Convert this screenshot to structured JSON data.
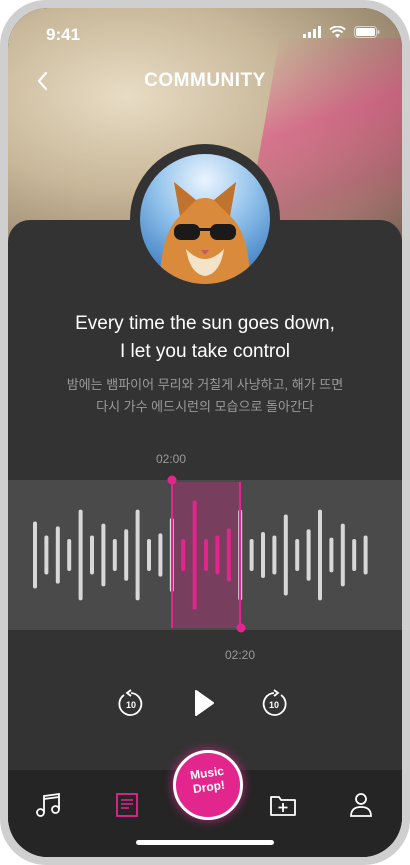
{
  "status": {
    "time": "9:41"
  },
  "header": {
    "title": "COMMUNITY"
  },
  "lyrics": {
    "english_line1": "Every time the sun goes down,",
    "english_line2": "I let you take control",
    "korean_line1": "밤에는 뱀파이어 무리와 거칠게 사냥하고, 해가 뜨면",
    "korean_line2": "다시 가수 에드시런의 모습으로 돌아간다"
  },
  "clip": {
    "start_time": "02:00",
    "end_time": "02:20"
  },
  "player": {
    "rewind_seconds": "10",
    "forward_seconds": "10"
  },
  "fab": {
    "label": "Music\nDrop!"
  },
  "tabs": [
    {
      "icon": "music-note-icon",
      "active": false
    },
    {
      "icon": "document-icon",
      "active": true
    },
    {
      "icon": "folder-add-icon",
      "active": false
    },
    {
      "icon": "user-icon",
      "active": false
    }
  ],
  "colors": {
    "accent": "#e2268e",
    "panel": "#333333",
    "tabbar": "#252525"
  },
  "waveform": [
    0.45,
    0.25,
    0.38,
    0.2,
    0.62,
    0.25,
    0.42,
    0.2,
    0.34,
    0.62,
    0.2,
    0.28,
    0.5,
    0.2,
    0.75,
    0.2,
    0.25,
    0.35,
    0.62,
    0.2,
    0.3,
    0.25,
    0.55,
    0.2,
    0.34,
    0.62,
    0.22,
    0.42,
    0.2,
    0.25
  ]
}
